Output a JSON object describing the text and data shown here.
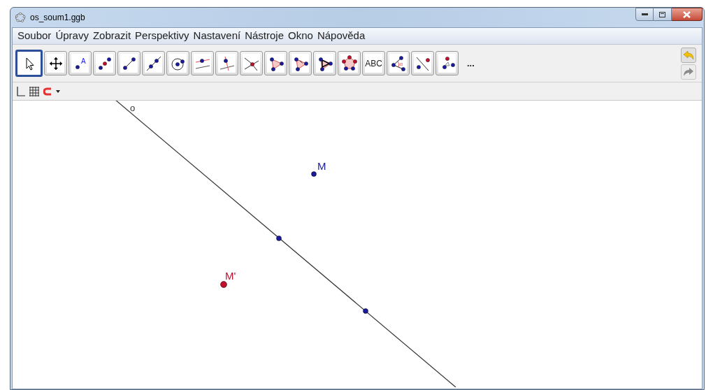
{
  "window": {
    "title": "os_soum1.ggb"
  },
  "menu": [
    "Soubor",
    "Úpravy",
    "Zobrazit",
    "Perspektivy",
    "Nastavení",
    "Nástroje",
    "Okno",
    "Nápověda"
  ],
  "tools": [
    {
      "kind": "select",
      "selected": true
    },
    {
      "kind": "move",
      "selected": false
    },
    {
      "kind": "point",
      "label": "A",
      "selected": false
    },
    {
      "kind": "midpoint",
      "selected": false
    },
    {
      "kind": "segment",
      "selected": false
    },
    {
      "kind": "line",
      "selected": false
    },
    {
      "kind": "circle",
      "selected": false
    },
    {
      "kind": "parallel",
      "selected": false
    },
    {
      "kind": "perpendicular",
      "selected": false
    },
    {
      "kind": "intersect",
      "selected": false
    },
    {
      "kind": "triangle",
      "selected": false
    },
    {
      "kind": "vector-triangle",
      "selected": false
    },
    {
      "kind": "rigid-triangle",
      "selected": false
    },
    {
      "kind": "polygon",
      "selected": false
    },
    {
      "kind": "text",
      "label": "ABC",
      "selected": false
    },
    {
      "kind": "angle",
      "label": "α",
      "selected": false
    },
    {
      "kind": "reflect",
      "selected": false
    },
    {
      "kind": "rotate",
      "selected": false
    }
  ],
  "more_tools": "...",
  "canvas": {
    "line": {
      "label": "o"
    },
    "points": [
      {
        "label": "M",
        "color": "#1a1aa0"
      },
      {
        "label": "M'",
        "color": "#c0102e"
      },
      {
        "color": "#1a1aa0"
      },
      {
        "color": "#1a1aa0"
      }
    ]
  }
}
